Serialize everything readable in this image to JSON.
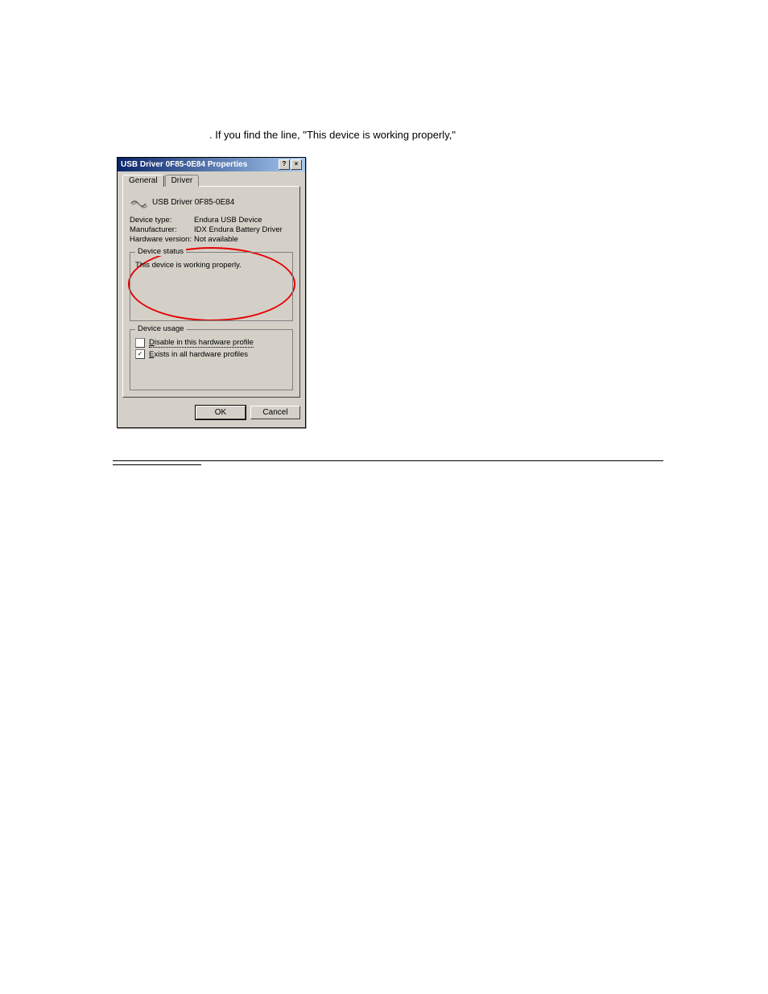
{
  "document": {
    "line1": ". If you find the line, \"This device is working properly,\""
  },
  "dialog": {
    "title": "USB Driver 0F85-0E84 Properties",
    "help_btn": "?",
    "close_btn": "×",
    "tabs": {
      "general": "General",
      "driver": "Driver"
    },
    "device_name": "USB Driver 0F85-0E84",
    "info": {
      "device_type_label": "Device type:",
      "device_type_value": "Endura USB Device",
      "manufacturer_label": "Manufacturer:",
      "manufacturer_value": "IDX Endura Battery Driver",
      "hw_version_label": "Hardware version:",
      "hw_version_value": "Not available"
    },
    "device_status": {
      "legend": "Device status",
      "text": "This device is working properly."
    },
    "device_usage": {
      "legend": "Device usage",
      "disable_prefix": "D",
      "disable_text": "isable in this hardware profile",
      "exists_prefix": "E",
      "exists_text": "xists in all hardware profiles"
    },
    "buttons": {
      "ok": "OK",
      "cancel": "Cancel"
    }
  }
}
